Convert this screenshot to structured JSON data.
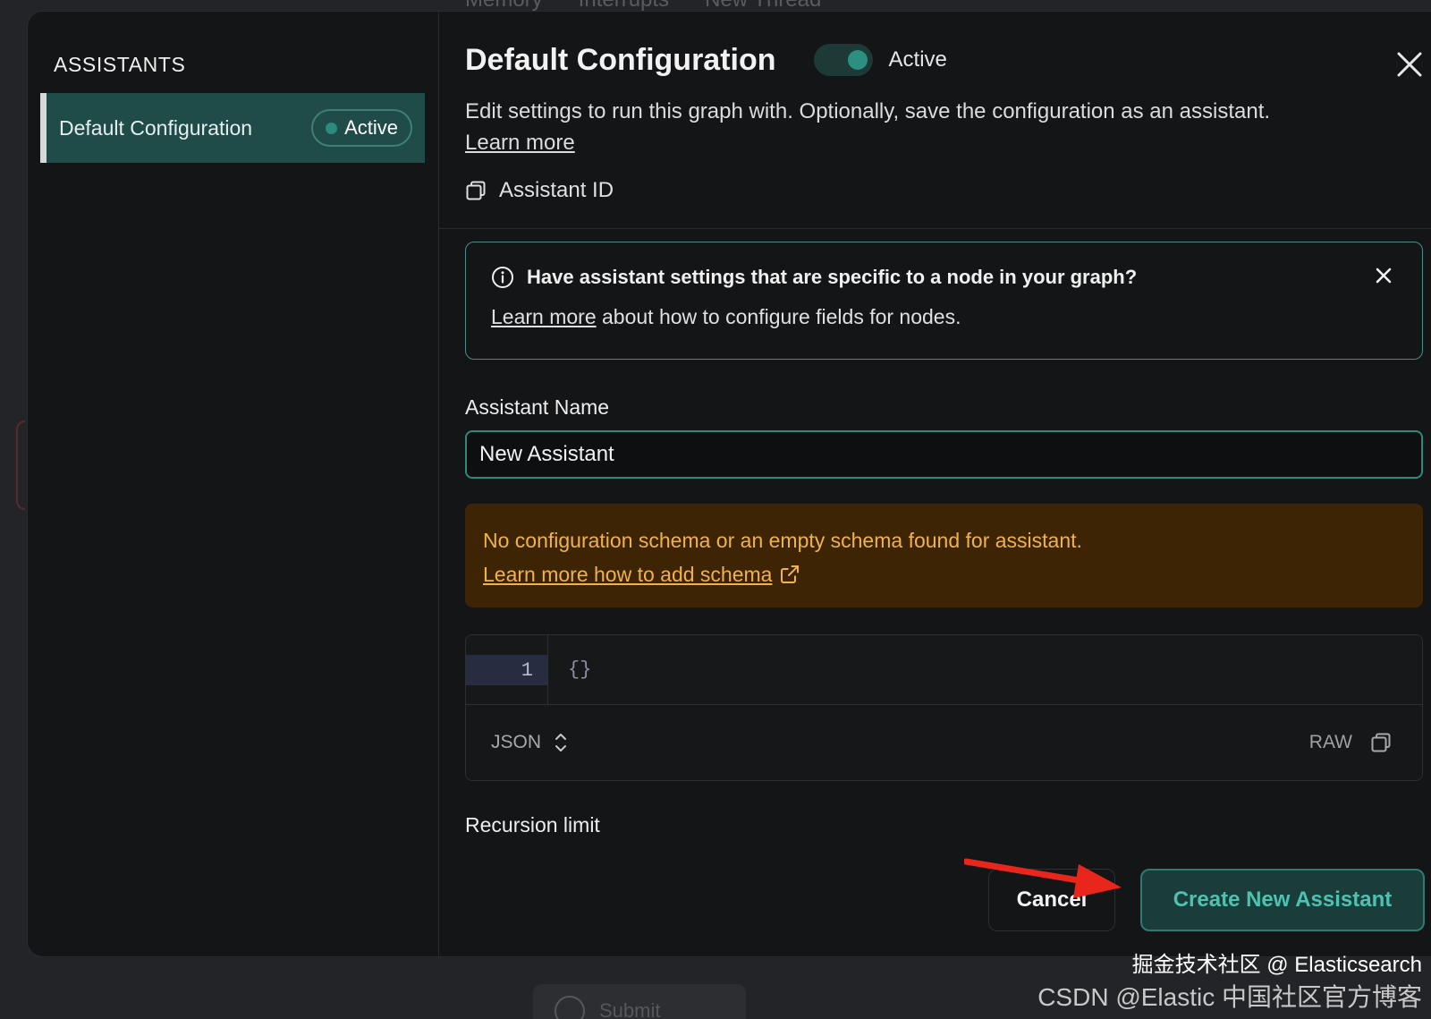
{
  "background": {
    "tabs": [
      "Memory",
      "Interrupts",
      "New Thread"
    ],
    "submit_label": "Submit"
  },
  "sidebar": {
    "title": "ASSISTANTS",
    "items": [
      {
        "label": "Default Configuration",
        "badge": "Active"
      }
    ]
  },
  "header": {
    "title": "Default Configuration",
    "toggle_label": "Active",
    "toggle_on": true,
    "description": "Edit settings to run this graph with. Optionally, save the configuration as an assistant.",
    "learn_more": "Learn more",
    "assistant_id_label": "Assistant ID"
  },
  "info_banner": {
    "heading": "Have assistant settings that are specific to a node in your graph?",
    "link": "Learn more",
    "text": " about how to configure fields for nodes."
  },
  "form": {
    "name_label": "Assistant Name",
    "name_value": "New Assistant",
    "recursion_label": "Recursion limit"
  },
  "warning": {
    "text": "No configuration schema or an empty schema found for assistant.",
    "link": "Learn more how to add schema"
  },
  "editor": {
    "line_number": "1",
    "code": "{}",
    "format": "JSON",
    "raw_label": "RAW"
  },
  "actions": {
    "cancel": "Cancel",
    "create": "Create New Assistant"
  },
  "watermark": {
    "line1": "掘金技术社区 @ Elasticsearch",
    "line2": "CSDN @Elastic 中国社区官方博客"
  },
  "colors": {
    "accent": "#2d8a7f",
    "warning_bg": "#3d2405",
    "warning_text": "#f0b24a",
    "arrow": "#e8261c"
  }
}
